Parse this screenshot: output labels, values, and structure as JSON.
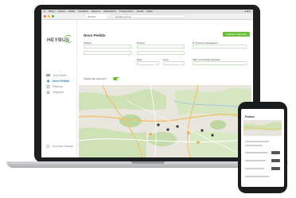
{
  "browser": {
    "menubar_items": [
      "Safari",
      "Arquivo",
      "Editar",
      "Visualizar",
      "Histórico",
      "Marcadores",
      "Programador",
      "Janela",
      "Ajuda"
    ],
    "tab_title": "Heybus",
    "url": "heybus.com.br"
  },
  "app": {
    "logo_text": "HEYBUS",
    "accent_color": "#6bbf3a",
    "sidebar": {
      "items": [
        {
          "label": "Tour Fretes",
          "icon": "bus-icon"
        },
        {
          "label": "Novo Pedido",
          "icon": "plus-icon",
          "active": true
        },
        {
          "label": "Pedidos",
          "icon": "list-icon"
        },
        {
          "label": "Viajantes",
          "icon": "users-icon"
        }
      ],
      "logout_label": "Encerrar Sessão"
    },
    "form": {
      "title": "Novo Pedido",
      "submit_label": "Solicitar orçamento",
      "fields": {
        "origin": "Partida",
        "destination": "Destino",
        "passengers": "Nº Total de passageiros",
        "date": "Data",
        "time": "Hora",
        "vehicle": "Valor (motorista) passante"
      },
      "return_trip_label": "Viagem de regresso?"
    }
  },
  "phone": {
    "title": "Pedido"
  }
}
